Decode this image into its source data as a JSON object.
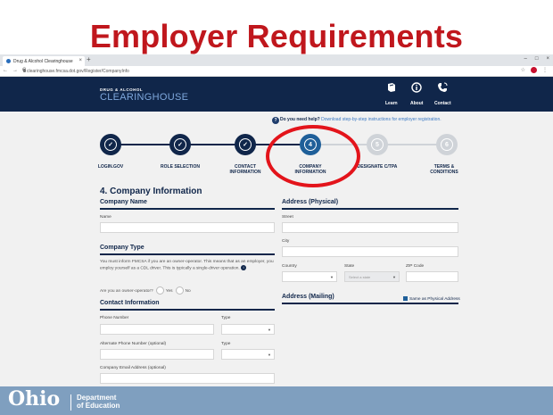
{
  "slide": {
    "title": "Employer Requirements"
  },
  "browser": {
    "tab_title": "Drug & Alcohol Clearinghouse",
    "tab_close": "×",
    "new_tab": "+",
    "url": "clearinghouse.fmcsa.dot.gov/Register/CompanyInfo",
    "window_controls": [
      "–",
      "□",
      "×"
    ]
  },
  "site": {
    "brand_small": "DRUG & ALCOHOL",
    "brand_big": "CLEARINGHOUSE",
    "nav": [
      {
        "label": "Learn",
        "icon": "book-icon"
      },
      {
        "label": "About",
        "icon": "info-icon"
      },
      {
        "label": "Contact",
        "icon": "phone-icon"
      }
    ]
  },
  "help": {
    "bold": "Do you need help?",
    "link": "Download step-by-step instructions for employer registration."
  },
  "steps": [
    {
      "label": "LOGIN.GOV",
      "number": "",
      "state": "done"
    },
    {
      "label": "ROLE SELECTION",
      "number": "",
      "state": "done"
    },
    {
      "label": "CONTACT INFORMATION",
      "number": "",
      "state": "done"
    },
    {
      "label": "COMPANY INFORMATION",
      "number": "4",
      "state": "active"
    },
    {
      "label": "DESIGNATE C/TPA",
      "number": "5",
      "state": "todo"
    },
    {
      "label": "TERMS & CONDITIONS",
      "number": "6",
      "state": "todo"
    }
  ],
  "form": {
    "heading": "4. Company Information",
    "company_name": {
      "title": "Company Name",
      "name_label": "Name"
    },
    "company_type": {
      "title": "Company Type",
      "paragraph": "You must inform FMCSA if you are an owner-operator. This means that as an employer, you employ yourself as a CDL driver. This is typically a single-driver operation.",
      "question": "Are you an owner-operator?",
      "yes": "Yes",
      "no": "No"
    },
    "contact": {
      "title": "Contact Information",
      "phone": "Phone Number",
      "type": "Type",
      "alt_phone": "Alternate Phone Number (optional)",
      "type2": "Type",
      "email": "Company Email Address (optional)"
    },
    "address_physical": {
      "title": "Address (Physical)",
      "street": "Street",
      "city": "City",
      "country": "Country",
      "state": "State",
      "state_placeholder": "Select a state",
      "zip": "ZIP Code"
    },
    "address_mailing": {
      "title": "Address (Mailing)",
      "same_label": "Same as Physical Address"
    }
  },
  "footer": {
    "logo": "Ohio",
    "dept_line1": "Department",
    "dept_line2": "of Education"
  },
  "colors": {
    "title_red": "#c0171d",
    "header_navy": "#10264a",
    "active_blue": "#1f5f99",
    "highlight_red": "#e3141b",
    "footer_blue": "#7f9fbf"
  }
}
